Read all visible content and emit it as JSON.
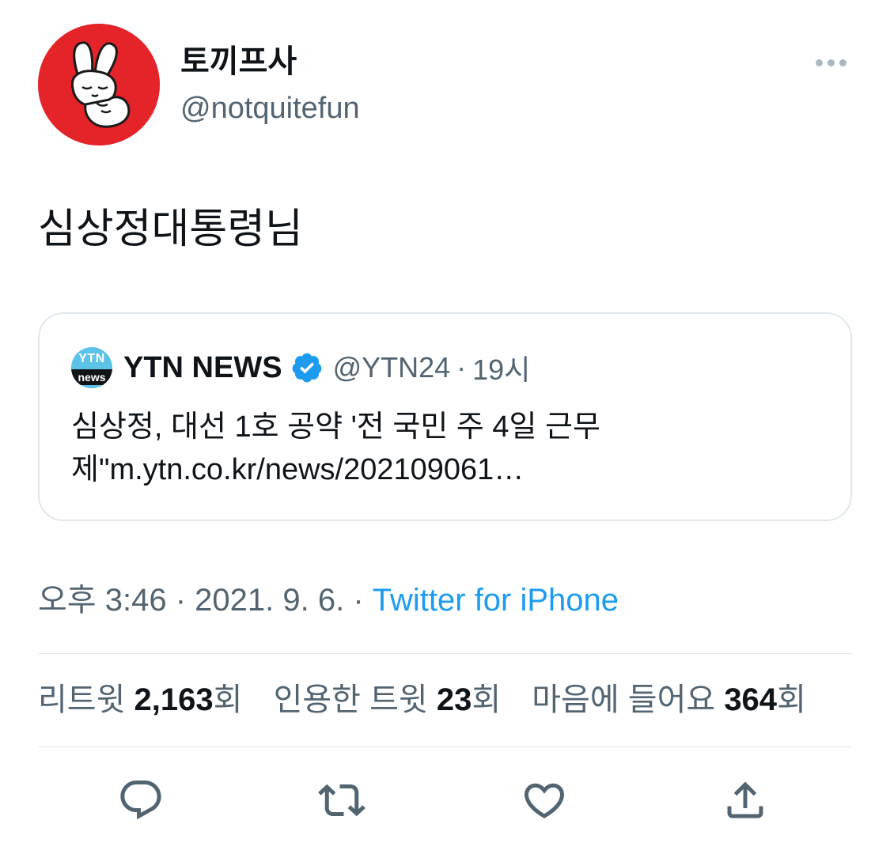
{
  "author": {
    "display_name": "토끼프사",
    "handle": "@notquitefun",
    "avatar_color": "#e5242a"
  },
  "tweet": {
    "text": "심상정대통령님"
  },
  "quote": {
    "name": "YTN NEWS",
    "logo_text_top": "YTN",
    "logo_text_bottom": "news",
    "handle": "@YTN24",
    "separator": "·",
    "time": "19시",
    "text": "심상정, 대선 1호 공약 '전 국민 주 4일 근무제\"m.ytn.co.kr/news/202109061…",
    "verified_icon": "verified-badge-icon"
  },
  "meta": {
    "time": "오후 3:46",
    "date": "2021. 9. 6.",
    "separator": "·",
    "source": "Twitter for iPhone",
    "source_color": "#1d9bf0"
  },
  "stats": {
    "retweets_label": "리트윗",
    "retweets_count": "2,163",
    "retweets_unit": "회",
    "quotes_label": "인용한 트윗",
    "quotes_count": "23",
    "quotes_unit": "회",
    "likes_label": "마음에 들어요",
    "likes_count": "364",
    "likes_unit": "회"
  },
  "actions": [
    "reply-icon",
    "retweet-icon",
    "like-icon",
    "share-icon"
  ],
  "colors": {
    "text": "#0f1419",
    "secondary": "#536471",
    "border": "#e1e8ed",
    "accent": "#1d9bf0"
  }
}
